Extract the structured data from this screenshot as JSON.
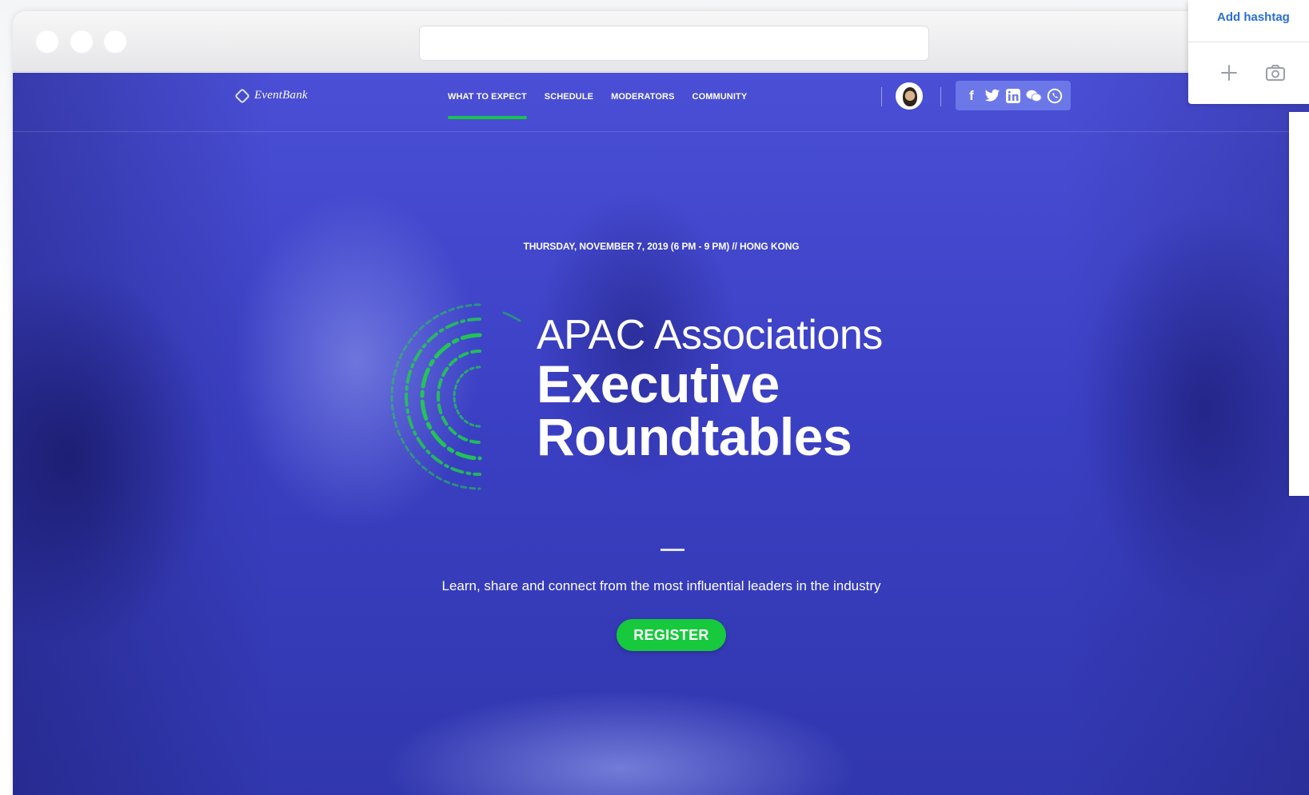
{
  "nav": {
    "logo": "EventBank",
    "links": [
      {
        "label": "WHAT TO EXPECT"
      },
      {
        "label": "SCHEDULE"
      },
      {
        "label": "MODERATORS"
      },
      {
        "label": "COMMUNITY"
      }
    ],
    "social_icons": [
      "facebook-icon",
      "twitter-icon",
      "linkedin-icon",
      "wechat-icon",
      "whatsapp-icon"
    ],
    "social_facebook": "f"
  },
  "hero": {
    "date_line": "THURSDAY, NOVEMBER 7, 2019 (6 PM - 9 PM) // HONG KONG",
    "title_light": "APAC Associations",
    "title_bold_1": "Executive",
    "title_bold_2": "Roundtables",
    "tagline": "Learn, share and connect from the most influential leaders in the industry",
    "register_label": "REGISTER"
  },
  "side_panel": {
    "add_hashtag": "Add hashtag",
    "icons": [
      "plus-icon",
      "camera-icon"
    ]
  },
  "colors": {
    "hero_blue": "#3b40c4",
    "accent_green": "#17c93c",
    "link_blue": "#2a6fd0"
  }
}
